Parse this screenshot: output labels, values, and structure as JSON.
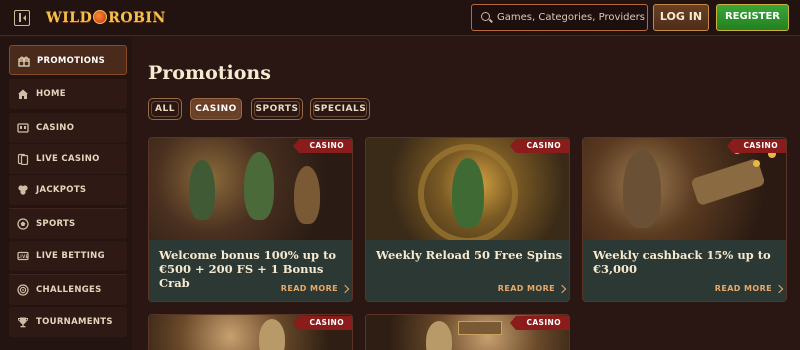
{
  "header": {
    "logo_text_left": "WILD",
    "logo_text_right": "ROBIN",
    "search_placeholder": "Games, Categories, Providers",
    "login_label": "LOG IN",
    "register_label": "REGISTER"
  },
  "sidebar": {
    "items": [
      {
        "label": "PROMOTIONS",
        "icon": "gift-icon",
        "active": true
      },
      {
        "label": "HOME",
        "icon": "home-icon",
        "active": false
      },
      {
        "label": "CASINO",
        "icon": "slot-machine-icon",
        "active": false
      },
      {
        "label": "LIVE CASINO",
        "icon": "cards-icon",
        "active": false
      },
      {
        "label": "JACKPOTS",
        "icon": "coins-icon",
        "active": false
      },
      {
        "label": "SPORTS",
        "icon": "ball-icon",
        "active": false
      },
      {
        "label": "LIVE BETTING",
        "icon": "live-icon",
        "active": false
      },
      {
        "label": "CHALLENGES",
        "icon": "target-icon",
        "active": false
      },
      {
        "label": "TOURNAMENTS",
        "icon": "trophy-icon",
        "active": false
      }
    ]
  },
  "main": {
    "title": "Promotions",
    "filters": [
      {
        "label": "ALL",
        "active": false
      },
      {
        "label": "CASINO",
        "active": true
      },
      {
        "label": "SPORTS",
        "active": false
      },
      {
        "label": "SPECIALS",
        "active": false
      }
    ],
    "cards": [
      {
        "badge": "CASINO",
        "title": "Welcome bonus 100% up to €500 + 200 FS + 1 Bonus Crab",
        "cta": "READ MORE"
      },
      {
        "badge": "CASINO",
        "title": "Weekly Reload 50 Free Spins",
        "cta": "READ MORE"
      },
      {
        "badge": "CASINO",
        "title": "Weekly cashback 15% up to €3,000",
        "cta": "READ MORE"
      },
      {
        "badge": "CASINO"
      },
      {
        "badge": "CASINO"
      }
    ]
  },
  "colors": {
    "background": "#2a1612",
    "accent_gold": "#f4c24a",
    "register_green": "#2e9a2a",
    "badge_red": "#8a1c1c",
    "read_more": "#e8a86a"
  }
}
